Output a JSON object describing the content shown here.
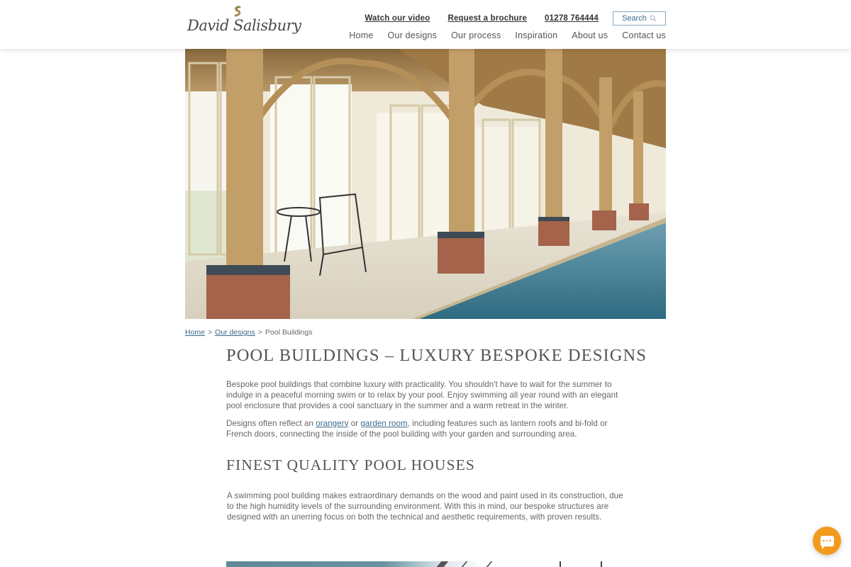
{
  "brand": {
    "name": "David Salisbury"
  },
  "header": {
    "utility_links": [
      {
        "label": "Watch our video"
      },
      {
        "label": "Request a brochure"
      },
      {
        "label": "01278 764444"
      }
    ],
    "search_label": "Search",
    "nav": [
      {
        "label": "Home"
      },
      {
        "label": "Our designs"
      },
      {
        "label": "Our process"
      },
      {
        "label": "Inspiration"
      },
      {
        "label": "About us"
      },
      {
        "label": "Contact us"
      }
    ]
  },
  "hero": {
    "alt": "Oak-framed indoor pool building with brick plinths, garden doors and a long swimming pool"
  },
  "breadcrumb": {
    "items": [
      {
        "label": "Home",
        "link": true
      },
      {
        "label": "Our designs",
        "link": true
      },
      {
        "label": "Pool Buildings",
        "link": false
      }
    ],
    "separator": ">"
  },
  "content": {
    "title": "POOL BUILDINGS – LUXURY BESPOKE DESIGNS",
    "para1": "Bespoke pool buildings that combine luxury with practicality. You shouldn't have to wait for the summer to indulge in a peaceful morning swim or to relax by your pool. Enjoy swimming all year round with an elegant pool enclosure that provides a cool sanctuary in the summer and a warm retreat in the winter.",
    "para2": {
      "before": "Designs often reflect an ",
      "link1": "orangery",
      "middle": " or ",
      "link2": "garden room",
      "after": ", including features such as lantern roofs and bi-fold or French doors, connecting the inside of the pool building with your garden and surrounding area."
    },
    "section_title": "FINEST QUALITY POOL HOUSES",
    "para3": "A swimming pool building makes extraordinary demands on the wood and paint used in its construction, due to the high humidity levels of the surrounding environment. With this in mind, our bespoke structures are designed with an unerring focus on both the technical and aesthetic requirements, with proven results."
  },
  "chat": {
    "icon": "chat-bubble-icon"
  },
  "colors": {
    "link": "#3c6a8a",
    "chat_accent": "#f39a1e",
    "text": "#555555"
  }
}
